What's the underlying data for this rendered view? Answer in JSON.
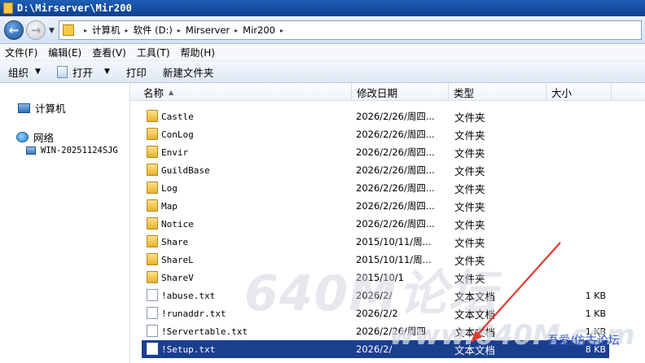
{
  "window": {
    "title": "D:\\Mirserver\\Mir200"
  },
  "address": {
    "crumbs": [
      "计算机",
      "软件 (D:)",
      "Mirserver",
      "Mir200"
    ]
  },
  "menu": [
    "文件(F)",
    "编辑(E)",
    "查看(V)",
    "工具(T)",
    "帮助(H)"
  ],
  "commands": {
    "organize": "组织",
    "open": "打开",
    "print": "打印",
    "new_folder": "新建文件夹"
  },
  "nav": {
    "computer": "计算机",
    "network": "网络",
    "host": "WIN-20251124SJG"
  },
  "columns": {
    "name": "名称",
    "date": "修改日期",
    "type": "类型",
    "size": "大小"
  },
  "files": [
    {
      "name": "Castle",
      "date": "2026/2/26/周四...",
      "type": "文件夹",
      "size": "",
      "kind": "folder"
    },
    {
      "name": "ConLog",
      "date": "2026/2/26/周四...",
      "type": "文件夹",
      "size": "",
      "kind": "folder"
    },
    {
      "name": "Envir",
      "date": "2026/2/26/周四...",
      "type": "文件夹",
      "size": "",
      "kind": "folder"
    },
    {
      "name": "GuildBase",
      "date": "2026/2/26/周四...",
      "type": "文件夹",
      "size": "",
      "kind": "folder"
    },
    {
      "name": "Log",
      "date": "2026/2/26/周四...",
      "type": "文件夹",
      "size": "",
      "kind": "folder"
    },
    {
      "name": "Map",
      "date": "2026/2/26/周四...",
      "type": "文件夹",
      "size": "",
      "kind": "folder"
    },
    {
      "name": "Notice",
      "date": "2026/2/26/周四...",
      "type": "文件夹",
      "size": "",
      "kind": "folder"
    },
    {
      "name": "Share",
      "date": "2015/10/11/周...",
      "type": "文件夹",
      "size": "",
      "kind": "folder"
    },
    {
      "name": "ShareL",
      "date": "2015/10/11/周...",
      "type": "文件夹",
      "size": "",
      "kind": "folder"
    },
    {
      "name": "ShareV",
      "date": "2015/10/1",
      "type": "文件夹",
      "size": "",
      "kind": "folder"
    },
    {
      "name": "!abuse.txt",
      "date": "2026/2/",
      "type": "文本文档",
      "size": "1 KB",
      "kind": "file"
    },
    {
      "name": "!runaddr.txt",
      "date": "2026/2/2",
      "type": "文本文档",
      "size": "1 KB",
      "kind": "file"
    },
    {
      "name": "!Servertable.txt",
      "date": "2026/2/26/周四",
      "type": "文本文档",
      "size": "1 KB",
      "kind": "file"
    },
    {
      "name": "!Setup.txt",
      "date": "2026/2/",
      "type": "文本文档",
      "size": "8 KB",
      "kind": "file",
      "selected": true
    }
  ],
  "watermark": {
    "brand": "640M论坛",
    "url": "www.640M.com",
    "tag": "吾爱/仿古论坛"
  },
  "colors": {
    "selection": "#1b3f8f",
    "title_bar": "#1f5fb8"
  }
}
